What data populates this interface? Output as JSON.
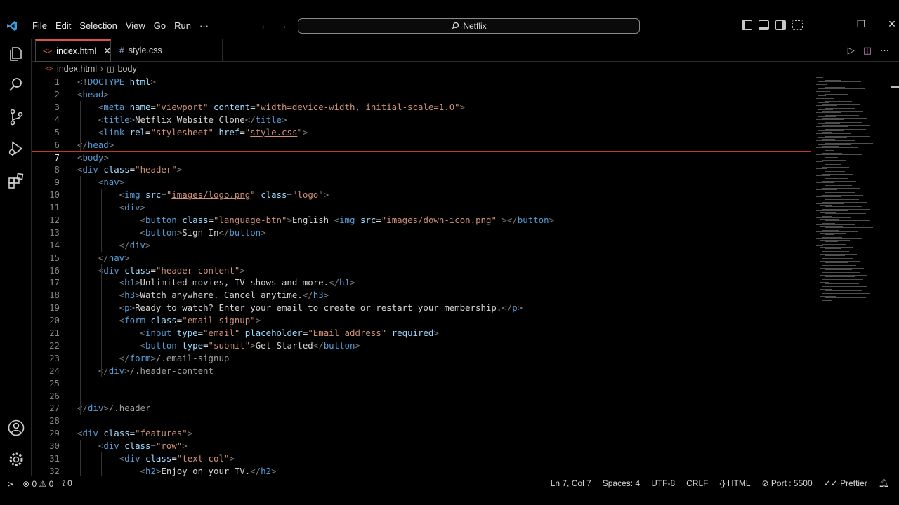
{
  "titlebar": {
    "menu": [
      "File",
      "Edit",
      "Selection",
      "View",
      "Go",
      "Run",
      "···"
    ],
    "back": "←",
    "forward": "→",
    "search_text": "Netflix",
    "window_controls": [
      "—",
      "❐",
      "✕"
    ]
  },
  "tabs": [
    {
      "label": "index.html",
      "icon": "html-icon",
      "active": true,
      "close": "✕"
    },
    {
      "label": "style.css",
      "icon": "css-icon",
      "active": false
    }
  ],
  "breadcrumb": {
    "file": "index.html",
    "symbol": "body"
  },
  "editor": {
    "current_line": 7,
    "lines": [
      {
        "n": "1",
        "html": "<span class='t'>&lt;!</span><span class='tn'>DOCTYPE</span> <span class='an'>html</span><span class='t'>&gt;</span>"
      },
      {
        "n": "2",
        "html": "<span class='t'>&lt;</span><span class='tn'>head</span><span class='t'>&gt;</span>"
      },
      {
        "n": "3",
        "html": "    <span class='t'>&lt;</span><span class='tn'>meta</span> <span class='an'>name</span>=<span class='av'>\"viewport\"</span> <span class='an'>content</span>=<span class='av'>\"width=device-width, initial-scale=1.0\"</span><span class='t'>&gt;</span>"
      },
      {
        "n": "4",
        "html": "    <span class='t'>&lt;</span><span class='tn'>title</span><span class='t'>&gt;</span>Netflix Website Clone<span class='t'>&lt;/</span><span class='tn'>title</span><span class='t'>&gt;</span>"
      },
      {
        "n": "5",
        "html": "    <span class='t'>&lt;</span><span class='tn'>link</span> <span class='an'>rel</span>=<span class='av'>\"stylesheet\"</span> <span class='an'>href</span>=<span class='av'>\"<span class='lnk'>style.css</span>\"</span><span class='t'>&gt;</span>"
      },
      {
        "n": "6",
        "html": "<span class='t'>&lt;/</span><span class='tn'>head</span><span class='t'>&gt;</span>"
      },
      {
        "n": "7",
        "html": "<span class='t'>&lt;</span><span class='tn'>body</span><span class='t'>&gt;</span>"
      },
      {
        "n": "8",
        "html": "<span class='t'>&lt;</span><span class='tn'>div</span> <span class='an'>class</span>=<span class='av'>\"header\"</span><span class='t'>&gt;</span>"
      },
      {
        "n": "9",
        "html": "    <span class='t'>&lt;</span><span class='tn'>nav</span><span class='t'>&gt;</span>"
      },
      {
        "n": "10",
        "html": "        <span class='t'>&lt;</span><span class='tn'>img</span> <span class='an'>src</span>=<span class='av'>\"<span class='lnk'>images/logo.png</span>\"</span> <span class='an'>class</span>=<span class='av'>\"logo\"</span><span class='t'>&gt;</span>"
      },
      {
        "n": "11",
        "html": "        <span class='t'>&lt;</span><span class='tn'>div</span><span class='t'>&gt;</span>"
      },
      {
        "n": "12",
        "html": "            <span class='t'>&lt;</span><span class='tn'>button</span> <span class='an'>class</span>=<span class='av'>\"language-btn\"</span><span class='t'>&gt;</span>English <span class='t'>&lt;</span><span class='tn'>img</span> <span class='an'>src</span>=<span class='av'>\"<span class='lnk'>images/down-icon.png</span>\"</span> <span class='t'>&gt;&lt;/</span><span class='tn'>button</span><span class='t'>&gt;</span>"
      },
      {
        "n": "13",
        "html": "            <span class='t'>&lt;</span><span class='tn'>button</span><span class='t'>&gt;</span>Sign In<span class='t'>&lt;/</span><span class='tn'>button</span><span class='t'>&gt;</span>"
      },
      {
        "n": "14",
        "html": "        <span class='t'>&lt;/</span><span class='tn'>div</span><span class='t'>&gt;</span>"
      },
      {
        "n": "15",
        "html": "    <span class='t'>&lt;/</span><span class='tn'>nav</span><span class='t'>&gt;</span>"
      },
      {
        "n": "16",
        "html": "    <span class='t'>&lt;</span><span class='tn'>div</span> <span class='an'>class</span>=<span class='av'>\"header-content\"</span><span class='t'>&gt;</span>"
      },
      {
        "n": "17",
        "html": "        <span class='t'>&lt;</span><span class='tn'>h1</span><span class='t'>&gt;</span>Unlimited movies, TV shows and more.<span class='t'>&lt;/</span><span class='tn'>h1</span><span class='t'>&gt;</span>"
      },
      {
        "n": "18",
        "html": "        <span class='t'>&lt;</span><span class='tn'>h3</span><span class='t'>&gt;</span>Watch anywhere. Cancel anytime.<span class='t'>&lt;/</span><span class='tn'>h3</span><span class='t'>&gt;</span>"
      },
      {
        "n": "19",
        "html": "        <span class='t'>&lt;</span><span class='tn'>p</span><span class='t'>&gt;</span>Ready to watch? Enter your email to create or restart your membership.<span class='t'>&lt;/</span><span class='tn'>p</span><span class='t'>&gt;</span>"
      },
      {
        "n": "20",
        "html": "        <span class='t'>&lt;</span><span class='tn'>form</span> <span class='an'>class</span>=<span class='av'>\"email-signup\"</span><span class='t'>&gt;</span>"
      },
      {
        "n": "21",
        "html": "            <span class='t'>&lt;</span><span class='tn'>input</span> <span class='an'>type</span>=<span class='av'>\"email\"</span> <span class='an'>placeholder</span>=<span class='av'>\"Email address\"</span> <span class='an'>required</span><span class='t'>&gt;</span>"
      },
      {
        "n": "22",
        "html": "            <span class='t'>&lt;</span><span class='tn'>button</span> <span class='an'>type</span>=<span class='av'>\"submit\"</span><span class='t'>&gt;</span>Get Started<span class='t'>&lt;/</span><span class='tn'>button</span><span class='t'>&gt;</span>"
      },
      {
        "n": "23",
        "html": "        <span class='t'>&lt;/</span><span class='tn'>form</span><span class='t'>&gt;</span><span class='cm'>/.email-signup</span>"
      },
      {
        "n": "24",
        "html": "    <span class='t'>&lt;/</span><span class='tn'>div</span><span class='t'>&gt;</span><span class='cm'>/.header-content</span>"
      },
      {
        "n": "25",
        "html": ""
      },
      {
        "n": "26",
        "html": ""
      },
      {
        "n": "27",
        "html": "<span class='t'>&lt;/</span><span class='tn'>div</span><span class='t'>&gt;</span><span class='cm'>/.header</span>"
      },
      {
        "n": "28",
        "html": ""
      },
      {
        "n": "29",
        "html": "<span class='t'>&lt;</span><span class='tn'>div</span> <span class='an'>class</span>=<span class='av'>\"features\"</span><span class='t'>&gt;</span>"
      },
      {
        "n": "30",
        "html": "    <span class='t'>&lt;</span><span class='tn'>div</span> <span class='an'>class</span>=<span class='av'>\"row\"</span><span class='t'>&gt;</span>"
      },
      {
        "n": "31",
        "html": "        <span class='t'>&lt;</span><span class='tn'>div</span> <span class='an'>class</span>=<span class='av'>\"text-col\"</span><span class='t'>&gt;</span>"
      },
      {
        "n": "32",
        "html": "            <span class='t'>&lt;</span><span class='tn'>h2</span><span class='t'>&gt;</span>Enjoy on your TV.<span class='t'>&lt;/</span><span class='tn'>h2</span><span class='t'>&gt;</span>"
      }
    ]
  },
  "statusbar": {
    "remote": "≻",
    "errors": "0",
    "warnings": "0",
    "ports": "0",
    "position": "Ln 7, Col 7",
    "spaces": "Spaces: 4",
    "encoding": "UTF-8",
    "eol": "CRLF",
    "language": "HTML",
    "live_server": "Port : 5500",
    "formatter": "Prettier"
  },
  "colors": {
    "accent_tab": "#d8534a",
    "tag": "#569cd6",
    "attr": "#9cdcfe",
    "string": "#ce9178"
  }
}
